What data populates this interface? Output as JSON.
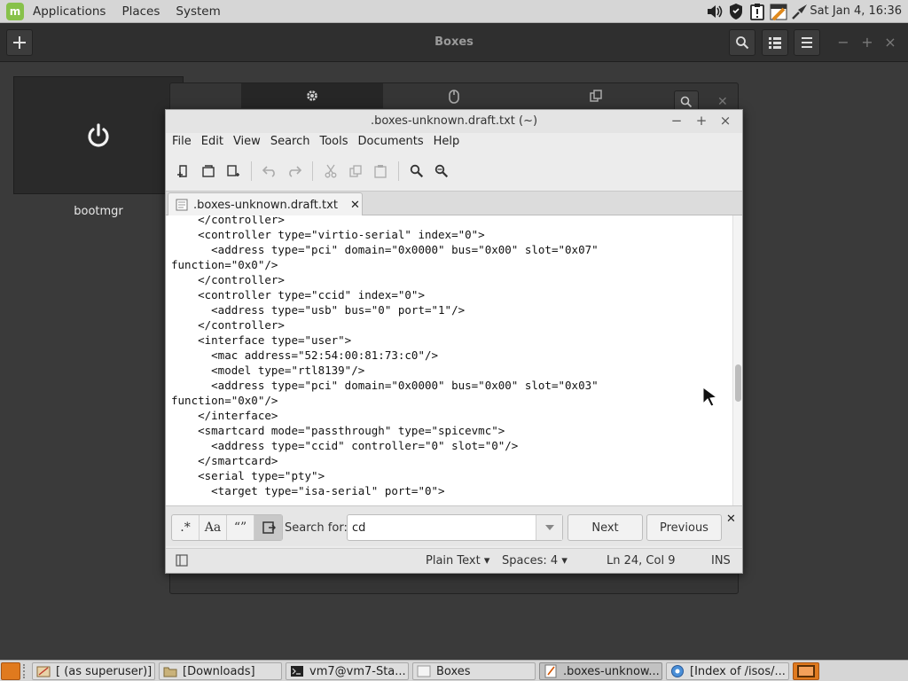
{
  "top_panel": {
    "menus": [
      "Applications",
      "Places",
      "System"
    ],
    "clock": "Sat Jan  4, 16:36",
    "tray_icons": [
      "volume-icon",
      "shield-icon",
      "clipboard-alert-icon",
      "calendar-icon",
      "network-icon"
    ]
  },
  "boxes": {
    "title": "Boxes",
    "vm_name": "bootmgr",
    "props_tabs": [
      "gear-icon",
      "mouse-icon",
      "copy-icon"
    ]
  },
  "gedit": {
    "title": ".boxes-unknown.draft.txt (~)",
    "menus": [
      "File",
      "Edit",
      "View",
      "Search",
      "Tools",
      "Documents",
      "Help"
    ],
    "tab_label": ".boxes-unknown.draft.txt",
    "code_lines": [
      "    </controller>",
      "    <controller type=\"virtio-serial\" index=\"0\">",
      "      <address type=\"pci\" domain=\"0x0000\" bus=\"0x00\" slot=\"0x07\"",
      "function=\"0x0\"/>",
      "    </controller>",
      "    <controller type=\"ccid\" index=\"0\">",
      "      <address type=\"usb\" bus=\"0\" port=\"1\"/>",
      "    </controller>",
      "    <interface type=\"user\">",
      "      <mac address=\"52:54:00:81:73:c0\"/>",
      "      <model type=\"rtl8139\"/>",
      "      <address type=\"pci\" domain=\"0x0000\" bus=\"0x00\" slot=\"0x03\"",
      "function=\"0x0\"/>",
      "    </interface>",
      "    <smartcard mode=\"passthrough\" type=\"spicevmc\">",
      "      <address type=\"ccid\" controller=\"0\" slot=\"0\"/>",
      "    </smartcard>",
      "    <serial type=\"pty\">",
      "      <target type=\"isa-serial\" port=\"0\">"
    ],
    "search": {
      "toggles": [
        ".*",
        "Aa",
        "“”",
        "wrap"
      ],
      "label": "Search for:",
      "value": "cd",
      "next": "Next",
      "previous": "Previous"
    },
    "status": {
      "language": "Plain Text",
      "spaces": "Spaces: 4",
      "position": "Ln 24, Col 9",
      "mode": "INS"
    }
  },
  "taskbar": {
    "tasks": [
      {
        "label": "[ (as superuser)]",
        "icon": "file-manager-icon"
      },
      {
        "label": "[Downloads]",
        "icon": "folder-icon"
      },
      {
        "label": "vm7@vm7-Sta...",
        "icon": "terminal-icon"
      },
      {
        "label": "Boxes",
        "icon": "boxes-icon"
      },
      {
        "label": ".boxes-unknow...",
        "icon": "text-editor-icon"
      },
      {
        "label": "[Index of /isos/...",
        "icon": "browser-icon"
      }
    ]
  }
}
